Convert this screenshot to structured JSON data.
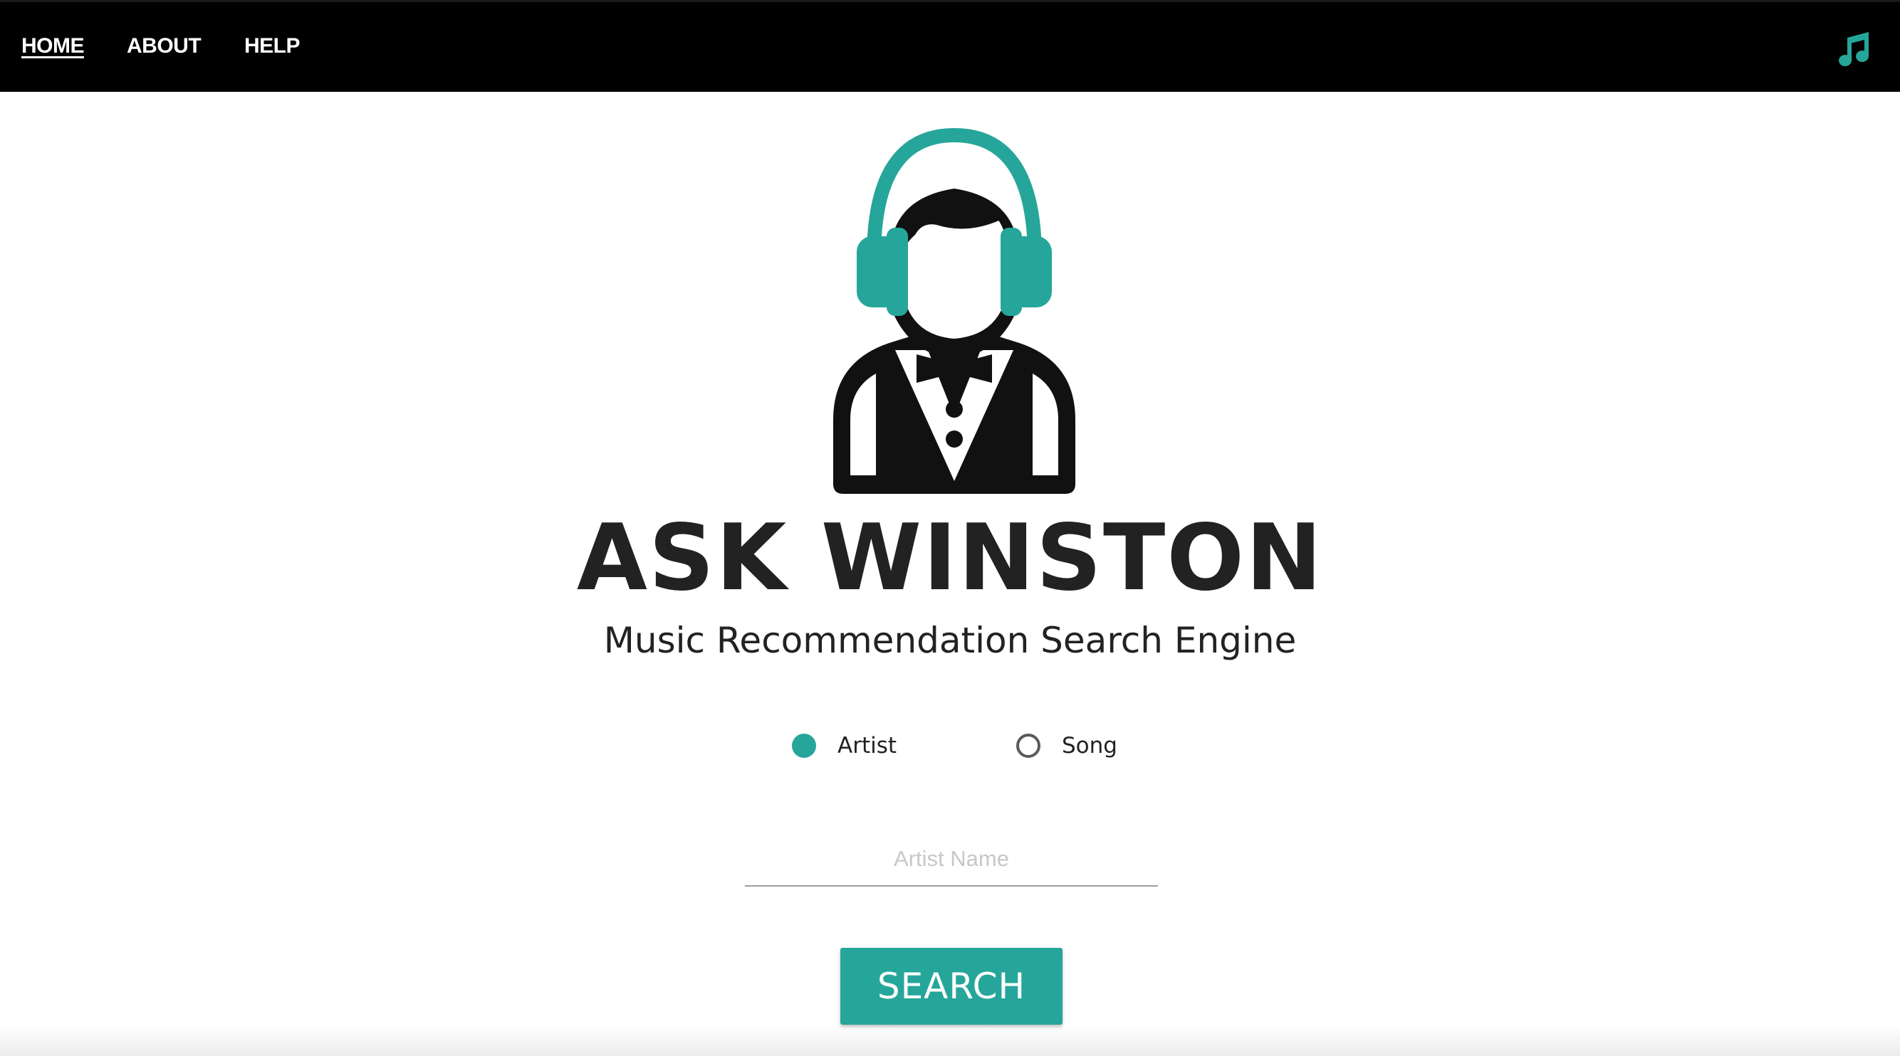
{
  "nav": {
    "items": [
      {
        "label": "HOME",
        "active": true
      },
      {
        "label": "ABOUT",
        "active": false
      },
      {
        "label": "HELP",
        "active": false
      }
    ],
    "icon": "music-note-icon"
  },
  "hero": {
    "logo_icon": "butler-with-headphones-icon",
    "title": "ASK WINSTON",
    "subtitle": "Music Recommendation Search Engine"
  },
  "search": {
    "options": [
      {
        "label": "Artist",
        "selected": true
      },
      {
        "label": "Song",
        "selected": false
      }
    ],
    "input_value": "",
    "placeholder": "Artist Name",
    "button_label": "SEARCH"
  },
  "colors": {
    "accent": "#26a69a",
    "navbar": "#000000",
    "text": "#222222"
  }
}
